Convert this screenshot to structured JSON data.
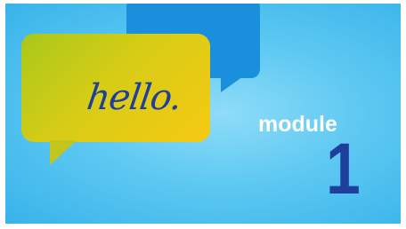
{
  "bubble": {
    "greeting": "hello."
  },
  "module": {
    "label": "module",
    "number": "1"
  },
  "colors": {
    "background": "#5ec9f2",
    "back_bubble": "#1a8fdc",
    "front_bubble_start": "#a8c81a",
    "front_bubble_end": "#f6c912",
    "text_dark_blue": "#1f3f9c",
    "text_white": "#ffffff"
  }
}
